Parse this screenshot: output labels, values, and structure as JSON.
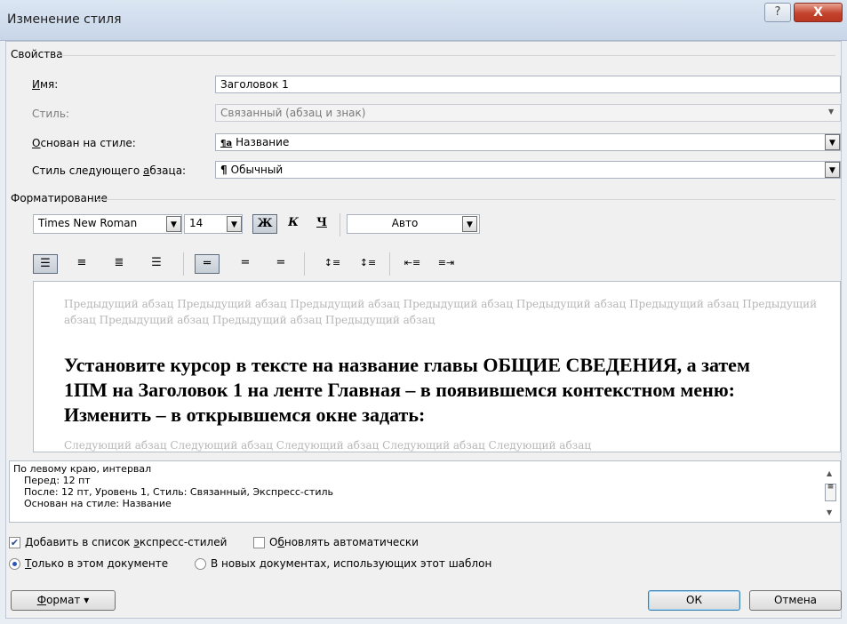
{
  "window": {
    "title": "Изменение стиля",
    "help_label": "?",
    "close_label": "X"
  },
  "properties": {
    "group_label": "Свойства",
    "name": {
      "label_prefix": "И",
      "label_rest": "мя:",
      "value": "Заголовок 1"
    },
    "style": {
      "label": "Стиль:",
      "value": "Связанный (абзац и знак)"
    },
    "based_on": {
      "label_prefix": "О",
      "label_rest": "снован на стиле:",
      "icon": "¶a",
      "value": "Название"
    },
    "next_style": {
      "label_a": "Стиль следующего ",
      "label_u": "а",
      "label_b": "бзаца:",
      "icon": "¶",
      "value": "Обычный"
    }
  },
  "formatting": {
    "group_label": "Форматирование",
    "font": "Times New Roman",
    "size": "14",
    "bold": "Ж",
    "italic": "К",
    "underline": "Ч",
    "color": "Авто"
  },
  "preview": {
    "previous": "Предыдущий абзац Предыдущий абзац Предыдущий абзац Предыдущий абзац Предыдущий абзац Предыдущий абзац Предыдущий абзац Предыдущий абзац Предыдущий абзац Предыдущий абзац",
    "main": "Установите курсор в тексте на название главы ОБЩИЕ СВЕДЕНИЯ, а затем 1ПМ на Заголовок 1 на ленте Главная – в появившемся контекстном меню: Изменить – в открывшемся окне задать:",
    "next": "Следующий абзац Следующий абзац Следующий абзац Следующий абзац Следующий абзац"
  },
  "description": {
    "line1": "По левому краю, интервал",
    "line2": "Перед:  12 пт",
    "line3": "После:  12 пт, Уровень 1, Стиль: Связанный, Экспресс-стиль",
    "line4": "Основан на стиле: Название"
  },
  "options": {
    "add_to_quick_a": "Добавить в список ",
    "add_to_quick_u": "э",
    "add_to_quick_b": "кспресс-стилей",
    "add_to_quick_checked": true,
    "auto_update_a": "О",
    "auto_update_u": "б",
    "auto_update_b": "новлять автоматически",
    "auto_update_checked": false,
    "only_this_doc_u": "Т",
    "only_this_doc_b": "олько в этом документе",
    "new_docs": "В новых документах, использующих этот шаблон"
  },
  "buttons": {
    "format_u": "Ф",
    "format_b": "ормат ▾",
    "ok": "ОК",
    "cancel": "Отмена"
  }
}
